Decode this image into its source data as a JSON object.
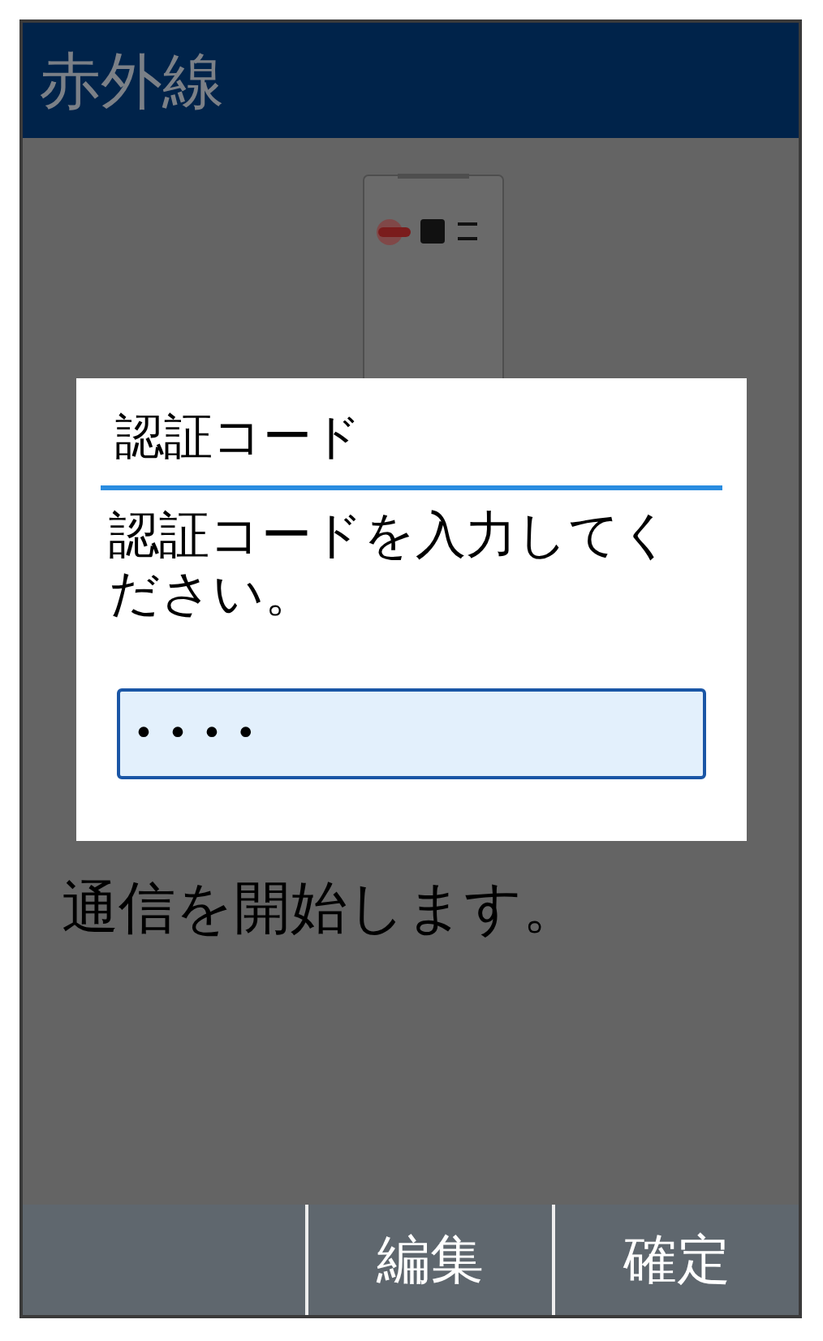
{
  "header": {
    "title": "赤外線"
  },
  "background_text": [
    {
      "text": "通信を開始します。"
    }
  ],
  "dialog": {
    "title": "認証コード",
    "message": "認証コードを入力してください。",
    "field": {
      "value": "••••",
      "focused": true
    }
  },
  "softkeys": [
    {
      "label": "編集"
    },
    {
      "label": "確定"
    }
  ]
}
